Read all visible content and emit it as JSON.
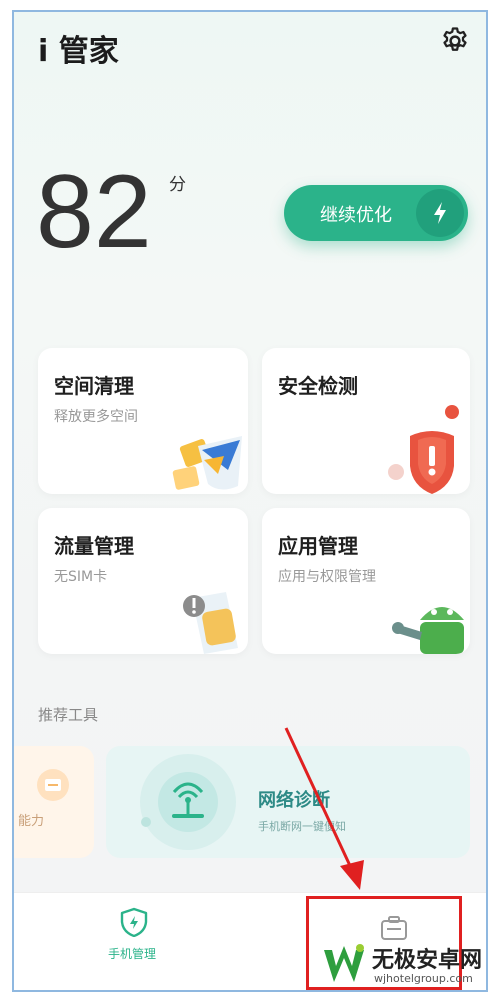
{
  "header": {
    "title": "i 管家"
  },
  "score": {
    "value": "82",
    "unit": "分"
  },
  "optimize": {
    "label": "继续优化"
  },
  "cards": [
    {
      "title": "空间清理",
      "subtitle": "释放更多空间"
    },
    {
      "title": "安全检测",
      "subtitle": ""
    },
    {
      "title": "流量管理",
      "subtitle": "无SIM卡"
    },
    {
      "title": "应用管理",
      "subtitle": "应用与权限管理"
    }
  ],
  "tools": {
    "section_title": "推荐工具",
    "partial_label": "能力",
    "network": {
      "title": "网络诊断",
      "subtitle": "手机断网一键便知"
    }
  },
  "bottom_nav": [
    {
      "label": "手机管理",
      "active": true,
      "icon": "shield-bolt-icon"
    },
    {
      "label": "",
      "active": false,
      "icon": "toolbox-icon"
    }
  ],
  "watermark": {
    "name": "无极安卓网",
    "url": "wjhotelgroup.com"
  },
  "colors": {
    "accent": "#2bb38a",
    "highlight_box": "#e02020"
  }
}
